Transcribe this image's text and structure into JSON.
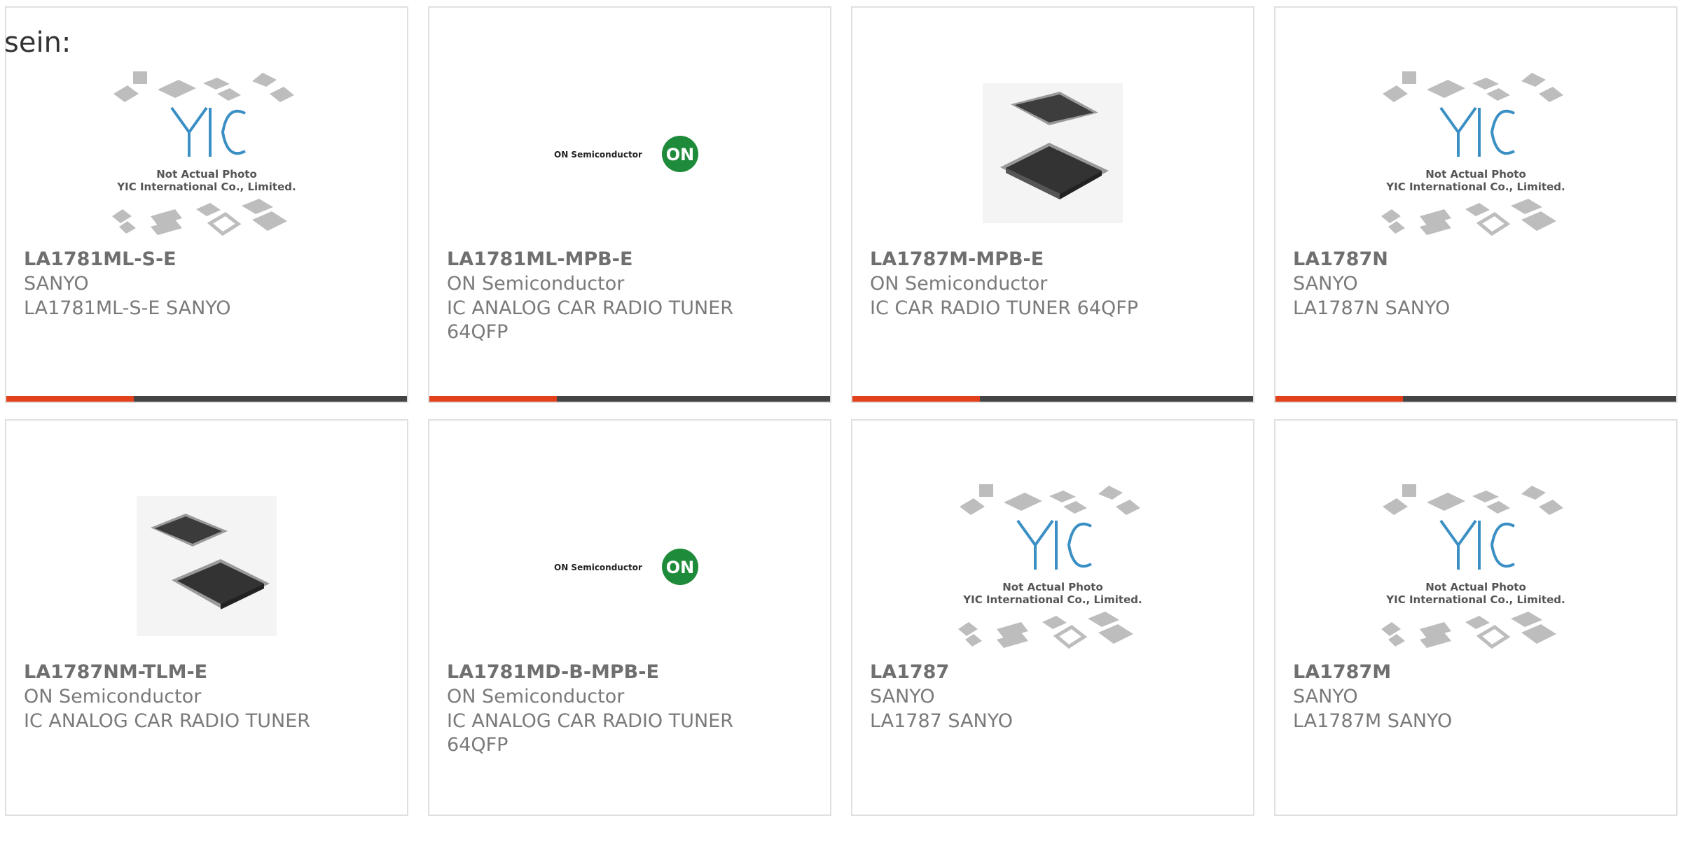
{
  "heading": "sein:",
  "colors": {
    "accent": "#e3401c",
    "bar": "#444444",
    "on_logo": "#1e8b3a"
  },
  "cards": [
    {
      "part": "LA1781ML-S-E",
      "manufacturer": "SANYO",
      "description": "LA1781ML-S-E SANYO",
      "image": "yic-placeholder",
      "image_text": {
        "line1": "Not Actual Photo",
        "line2": "YIC International Co., Limited."
      }
    },
    {
      "part": "LA1781ML-MPB-E",
      "manufacturer": "ON Semiconductor",
      "description": "IC ANALOG CAR RADIO TUNER 64QFP",
      "image": "on-semi-logo",
      "logo_text": "ON Semiconductor",
      "logo_mark": "ON"
    },
    {
      "part": "LA1787M-MPB-E",
      "manufacturer": "ON Semiconductor",
      "description": "IC CAR RADIO TUNER 64QFP",
      "image": "qfp-chip-photo"
    },
    {
      "part": "LA1787N",
      "manufacturer": "SANYO",
      "description": "LA1787N SANYO",
      "image": "yic-placeholder",
      "image_text": {
        "line1": "Not Actual Photo",
        "line2": "YIC International Co., Limited."
      }
    },
    {
      "part": "LA1787NM-TLM-E",
      "manufacturer": "ON Semiconductor",
      "description": "IC ANALOG CAR RADIO TUNER",
      "image": "qfp-chip-photo"
    },
    {
      "part": "LA1781MD-B-MPB-E",
      "manufacturer": "ON Semiconductor",
      "description": "IC ANALOG CAR RADIO TUNER 64QFP",
      "image": "on-semi-logo",
      "logo_text": "ON Semiconductor",
      "logo_mark": "ON"
    },
    {
      "part": "LA1787",
      "manufacturer": "SANYO",
      "description": "LA1787 SANYO",
      "image": "yic-placeholder",
      "image_text": {
        "line1": "Not Actual Photo",
        "line2": "YIC International Co., Limited."
      }
    },
    {
      "part": "LA1787M",
      "manufacturer": "SANYO",
      "description": "LA1787M SANYO",
      "image": "yic-placeholder",
      "image_text": {
        "line1": "Not Actual Photo",
        "line2": "YIC International Co., Limited."
      }
    }
  ]
}
